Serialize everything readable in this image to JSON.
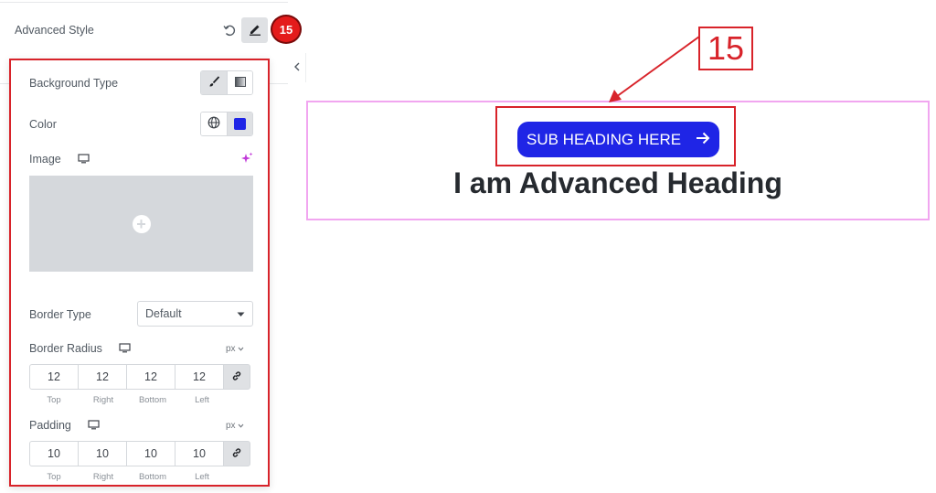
{
  "panel": {
    "section_label": "Advanced Style",
    "step_badge": "15",
    "icons": [
      "reset-icon",
      "pencil-icon",
      "chevron-left-icon"
    ]
  },
  "popover": {
    "background_type_label": "Background Type",
    "color_label": "Color",
    "color_swatch": "#1f25e6",
    "image_label": "Image",
    "border_type_label": "Border Type",
    "border_type_value": "Default",
    "border_radius": {
      "label": "Border Radius",
      "unit": "px",
      "values": [
        "12",
        "12",
        "12",
        "12"
      ],
      "sides": [
        "Top",
        "Right",
        "Bottom",
        "Left"
      ]
    },
    "padding": {
      "label": "Padding",
      "unit": "px",
      "values": [
        "10",
        "10",
        "10",
        "10"
      ],
      "sides": [
        "Top",
        "Right",
        "Bottom",
        "Left"
      ]
    }
  },
  "preview": {
    "sub_heading": "SUB HEADING HERE",
    "heading": "I am Advanced Heading",
    "accent": "#1f25e6"
  },
  "annotation": {
    "callout_number": "15",
    "highlight_color": "#d8232a"
  }
}
